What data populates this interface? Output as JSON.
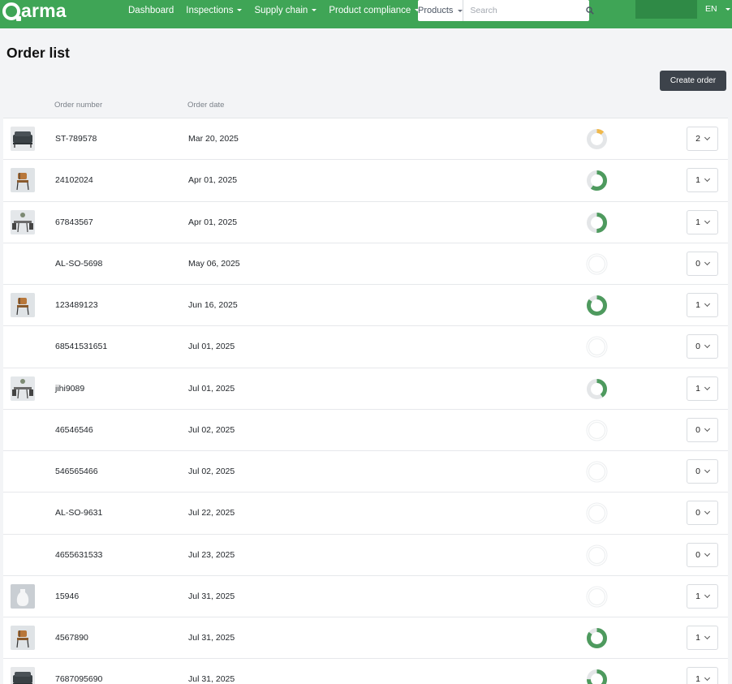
{
  "brand": {
    "name": "arma",
    "accent": "#3fa556"
  },
  "nav": [
    {
      "label": "Dashboard",
      "dropdown": false
    },
    {
      "label": "Inspections",
      "dropdown": true
    },
    {
      "label": "Supply chain",
      "dropdown": true
    },
    {
      "label": "Product compliance",
      "dropdown": true
    }
  ],
  "search": {
    "scope": "Products",
    "placeholder": "Search"
  },
  "language": "EN",
  "page": {
    "title": "Order list",
    "create_label": "Create order"
  },
  "columns": {
    "order_number": "Order number",
    "order_date": "Order date"
  },
  "orders": [
    {
      "number": "ST-789578",
      "date": "Mar 20, 2025",
      "thumb": "sofa",
      "progress": 0.12,
      "progress_color": "#f0b84a",
      "qty": "2"
    },
    {
      "number": "24102024",
      "date": "Apr 01, 2025",
      "thumb": "chair",
      "progress": 0.6,
      "progress_color": "#4e9a5e",
      "qty": "1"
    },
    {
      "number": "67843567",
      "date": "Apr 01, 2025",
      "thumb": "dining",
      "progress": 0.5,
      "progress_color": "#4e9a5e",
      "qty": "1"
    },
    {
      "number": "AL-SO-5698",
      "date": "May 06, 2025",
      "thumb": "none",
      "progress": 0,
      "progress_color": "#4e9a5e",
      "qty": "0"
    },
    {
      "number": "123489123",
      "date": "Jun 16, 2025",
      "thumb": "chair",
      "progress": 0.85,
      "progress_color": "#4e9a5e",
      "qty": "1"
    },
    {
      "number": "68541531651",
      "date": "Jul 01, 2025",
      "thumb": "none",
      "progress": 0,
      "progress_color": "#4e9a5e",
      "qty": "0"
    },
    {
      "number": "jihi9089",
      "date": "Jul 01, 2025",
      "thumb": "dining",
      "progress": 0.4,
      "progress_color": "#4e9a5e",
      "qty": "1"
    },
    {
      "number": "46546546",
      "date": "Jul 02, 2025",
      "thumb": "none",
      "progress": 0,
      "progress_color": "#4e9a5e",
      "qty": "0"
    },
    {
      "number": "546565466",
      "date": "Jul 02, 2025",
      "thumb": "none",
      "progress": 0,
      "progress_color": "#4e9a5e",
      "qty": "0"
    },
    {
      "number": "AL-SO-9631",
      "date": "Jul 22, 2025",
      "thumb": "none",
      "progress": 0,
      "progress_color": "#4e9a5e",
      "qty": "0"
    },
    {
      "number": "4655631533",
      "date": "Jul 23, 2025",
      "thumb": "none",
      "progress": 0,
      "progress_color": "#4e9a5e",
      "qty": "0"
    },
    {
      "number": "15946",
      "date": "Jul 31, 2025",
      "thumb": "vase",
      "progress": 0,
      "progress_color": "#4e9a5e",
      "qty": "1"
    },
    {
      "number": "4567890",
      "date": "Jul 31, 2025",
      "thumb": "chair",
      "progress": 0.85,
      "progress_color": "#4e9a5e",
      "qty": "1"
    },
    {
      "number": "7687095690",
      "date": "Jul 31, 2025",
      "thumb": "sofa",
      "progress": 0.75,
      "progress_color": "#4e9a5e",
      "qty": "1"
    }
  ]
}
